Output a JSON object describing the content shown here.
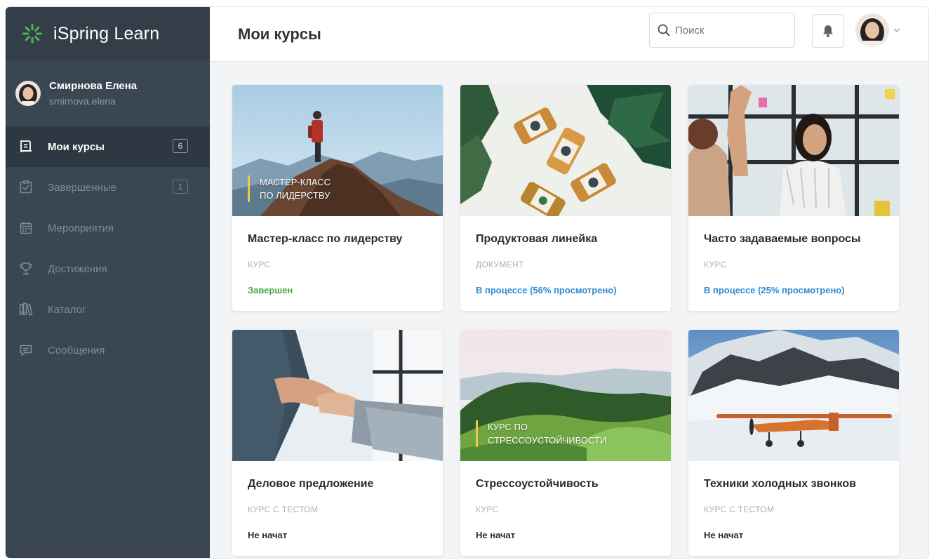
{
  "app": {
    "name": "iSpring Learn"
  },
  "user": {
    "name": "Смирнова Елена",
    "login": "smirnova.elena"
  },
  "sidebar": {
    "items": [
      {
        "label": "Мои курсы",
        "icon": "book-icon",
        "badge": "6",
        "active": true
      },
      {
        "label": "Завершенные",
        "icon": "checked-clipboard-icon",
        "badge": "1",
        "active": false
      },
      {
        "label": "Мероприятия",
        "icon": "calendar-icon",
        "badge": "",
        "active": false
      },
      {
        "label": "Достижения",
        "icon": "trophy-icon",
        "badge": "",
        "active": false
      },
      {
        "label": "Каталог",
        "icon": "library-icon",
        "badge": "",
        "active": false
      },
      {
        "label": "Сообщения",
        "icon": "message-icon",
        "badge": "",
        "active": false
      }
    ]
  },
  "header": {
    "title": "Мои курсы",
    "search_placeholder": "Поиск"
  },
  "colors": {
    "sidebar_bg": "#3a4652",
    "brand_bg": "#333e49",
    "accent_green": "#4cb84a",
    "status_done": "#44a84a",
    "status_progress": "#2f8bd3",
    "status_new": "#262c32",
    "overlay_bar": "#f3c84a"
  },
  "courses": [
    {
      "title": "Мастер-класс по лидерству",
      "type": "Курс",
      "status": "Завершен",
      "status_kind": "done",
      "overlay": [
        "Мастер-класс",
        "по лидерству"
      ],
      "image": "mountain-climber-image"
    },
    {
      "title": "Продуктовая линейка",
      "type": "Документ",
      "status": "В процессе (56% просмотрено)",
      "status_kind": "progress",
      "progress_percent": 56,
      "overlay": [],
      "image": "juice-bottles-image"
    },
    {
      "title": "Часто задаваемые вопросы",
      "type": "Курс",
      "status": "В процессе (25% просмотрено)",
      "status_kind": "progress",
      "progress_percent": 25,
      "overlay": [],
      "image": "office-meeting-image"
    },
    {
      "title": "Деловое предложение",
      "type": "Курс с тестом",
      "status": "Не начат",
      "status_kind": "new",
      "overlay": [],
      "image": "handshake-image"
    },
    {
      "title": "Стрессоустойчивость",
      "type": "Курс",
      "status": "Не начат",
      "status_kind": "new",
      "overlay": [
        "Курс по",
        "стрессоустойчивости"
      ],
      "image": "green-hills-image"
    },
    {
      "title": "Техники холодных звонков",
      "type": "Курс с тестом",
      "status": "Не начат",
      "status_kind": "new",
      "overlay": [],
      "image": "snow-plane-image"
    }
  ]
}
